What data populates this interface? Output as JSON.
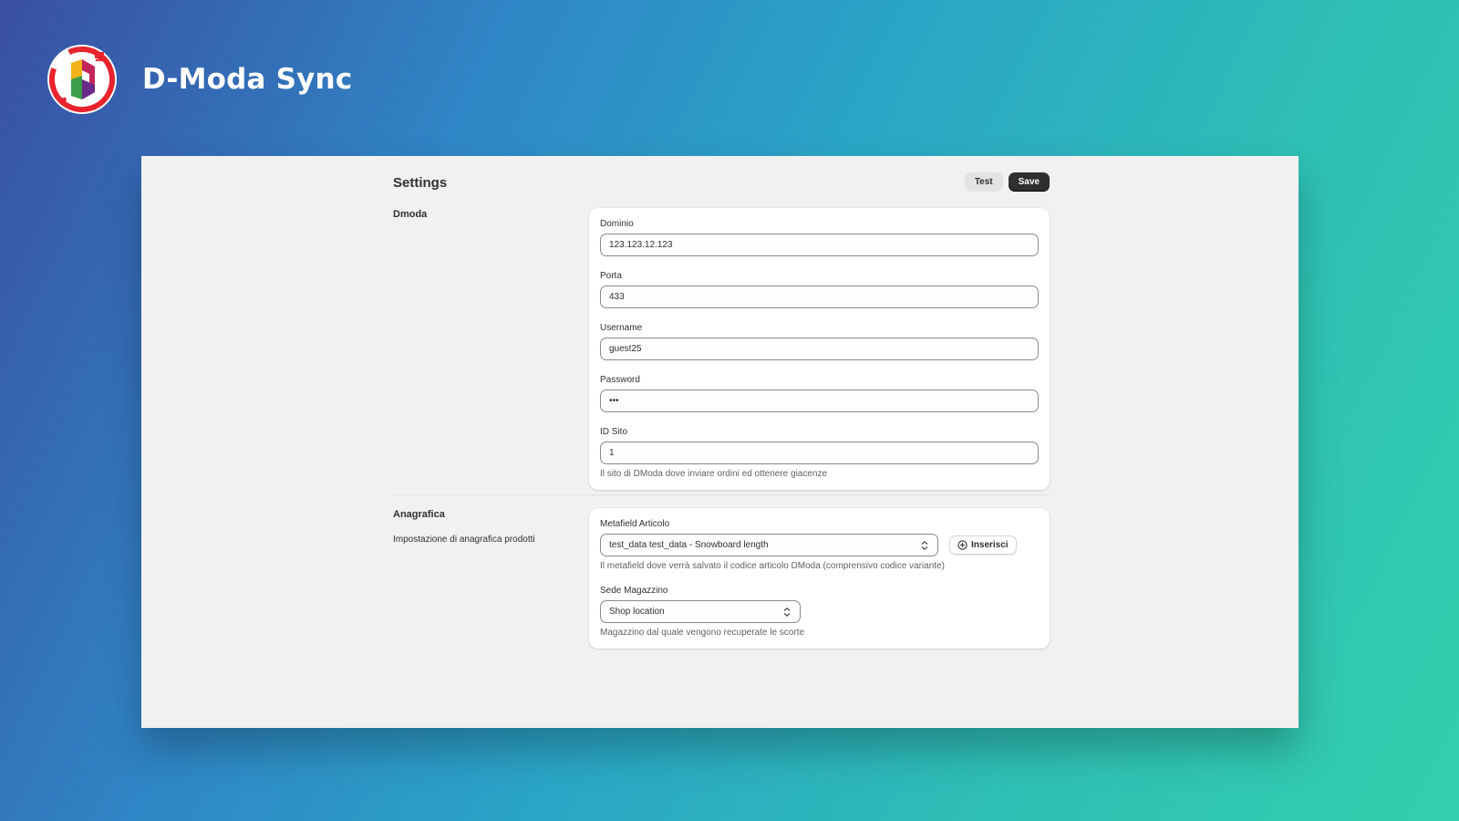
{
  "app": {
    "name": "D-Moda Sync",
    "logo_icon": "d-moda-sync-logo-icon"
  },
  "header": {
    "title": "Settings",
    "test_label": "Test",
    "save_label": "Save"
  },
  "dmoda": {
    "title": "Dmoda",
    "fields": {
      "dominio": {
        "label": "Dominio",
        "value": "123.123.12.123"
      },
      "porta": {
        "label": "Porta",
        "value": "433"
      },
      "username": {
        "label": "Username",
        "value": "guest25"
      },
      "password": {
        "label": "Password",
        "value": "•••"
      },
      "id_sito": {
        "label": "ID Sito",
        "value": "1",
        "help": "Il sito di DModa dove inviare ordini ed ottenere giacenze"
      }
    }
  },
  "anagrafica": {
    "title": "Anagrafica",
    "description": "Impostazione di anagrafica prodotti",
    "metafield": {
      "label": "Metafield Articolo",
      "value": "test_data test_data - Snowboard length",
      "help": "Il metafield dove verrà salvato il codice articolo DModa (comprensivo codice variante)",
      "insert_label": "Inserisci"
    },
    "sede": {
      "label": "Sede Magazzino",
      "value": "Shop location",
      "help": "Magazzino dal quale vengono recuperate le scorte"
    }
  },
  "colors": {
    "primary_button": "#303030",
    "panel_bg": "#f1f1f1",
    "logo_red": "#e8232e"
  }
}
